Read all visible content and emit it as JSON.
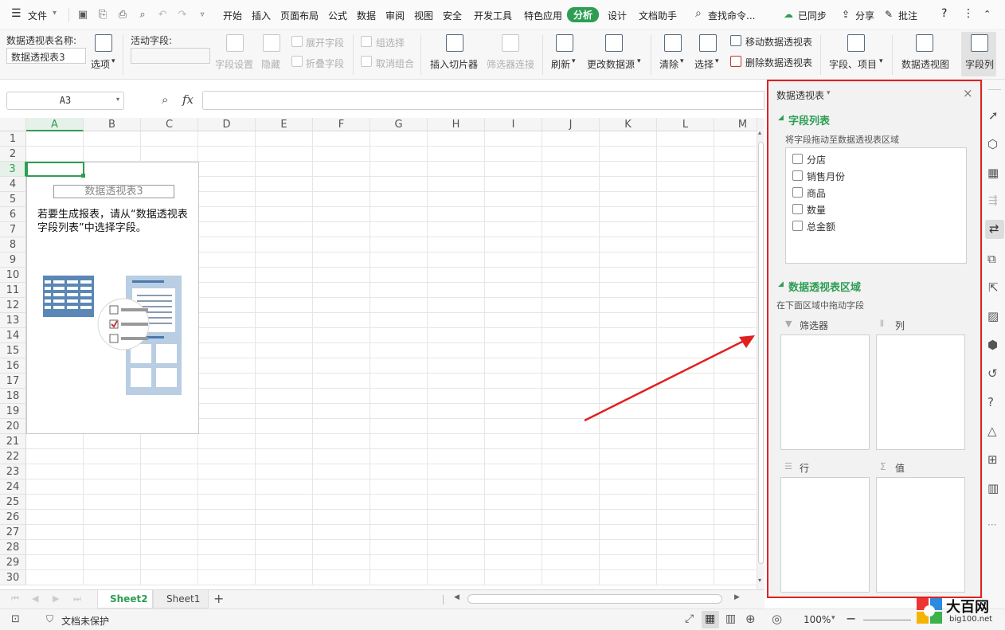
{
  "menu": {
    "file": "文件",
    "tabs": [
      "开始",
      "插入",
      "页面布局",
      "公式",
      "数据",
      "审阅",
      "视图",
      "安全",
      "开发工具",
      "特色应用",
      "分析",
      "设计",
      "文档助手"
    ],
    "active_tab": "分析",
    "search": "查找命令...",
    "sync": "已同步",
    "share": "分享",
    "comment": "批注"
  },
  "ribbon": {
    "pivot_name_label": "数据透视表名称:",
    "pivot_name_value": "数据透视表3",
    "options": "选项",
    "active_field_label": "活动字段:",
    "field_settings": "字段设置",
    "hide": "隐藏",
    "expand_field": "展开字段",
    "collapse_field": "折叠字段",
    "group_selection": "组选择",
    "ungroup": "取消组合",
    "insert_slicer": "插入切片器",
    "filter_connections": "筛选器连接",
    "refresh": "刷新",
    "change_source": "更改数据源",
    "clear": "清除",
    "select": "选择",
    "move_pivot": "移动数据透视表",
    "delete_pivot": "删除数据透视表",
    "fields_items": "字段、项目",
    "pivot_chart": "数据透视图",
    "field_list": "字段列"
  },
  "formula": {
    "cell_ref": "A3",
    "fx": "fx"
  },
  "grid": {
    "columns": [
      "A",
      "B",
      "C",
      "D",
      "E",
      "F",
      "G",
      "H",
      "I",
      "J",
      "K",
      "L",
      "M"
    ],
    "rows": [
      "1",
      "2",
      "3",
      "4",
      "5",
      "6",
      "7",
      "8",
      "9",
      "10",
      "11",
      "12",
      "13",
      "14",
      "15",
      "16",
      "17",
      "18",
      "19",
      "20",
      "21",
      "22",
      "23",
      "24",
      "25",
      "26",
      "27",
      "28",
      "29",
      "30"
    ],
    "pivot_placeholder_title": "数据透视表3",
    "pivot_placeholder_hint": "若要生成报表，请从“数据透视表字段列表”中选择字段。"
  },
  "sheets": {
    "tabs": [
      "Sheet2",
      "Sheet1"
    ],
    "active": "Sheet2",
    "add": "+"
  },
  "status": {
    "protect": "文档未保护",
    "zoom": "100%"
  },
  "panel": {
    "title": "数据透视表",
    "field_list_heading": "字段列表",
    "field_list_hint": "将字段拖动至数据透视表区域",
    "fields": [
      "分店",
      "销售月份",
      "商品",
      "数量",
      "总金额"
    ],
    "areas_heading": "数据透视表区域",
    "areas_hint": "在下面区域中拖动字段",
    "area_filter": "筛选器",
    "area_columns": "列",
    "area_rows": "行",
    "area_values": "值"
  },
  "watermark": {
    "brand": "大百网",
    "url": "big100.net"
  },
  "colors": {
    "accent": "#2e9e55",
    "highlight": "#e02020"
  }
}
